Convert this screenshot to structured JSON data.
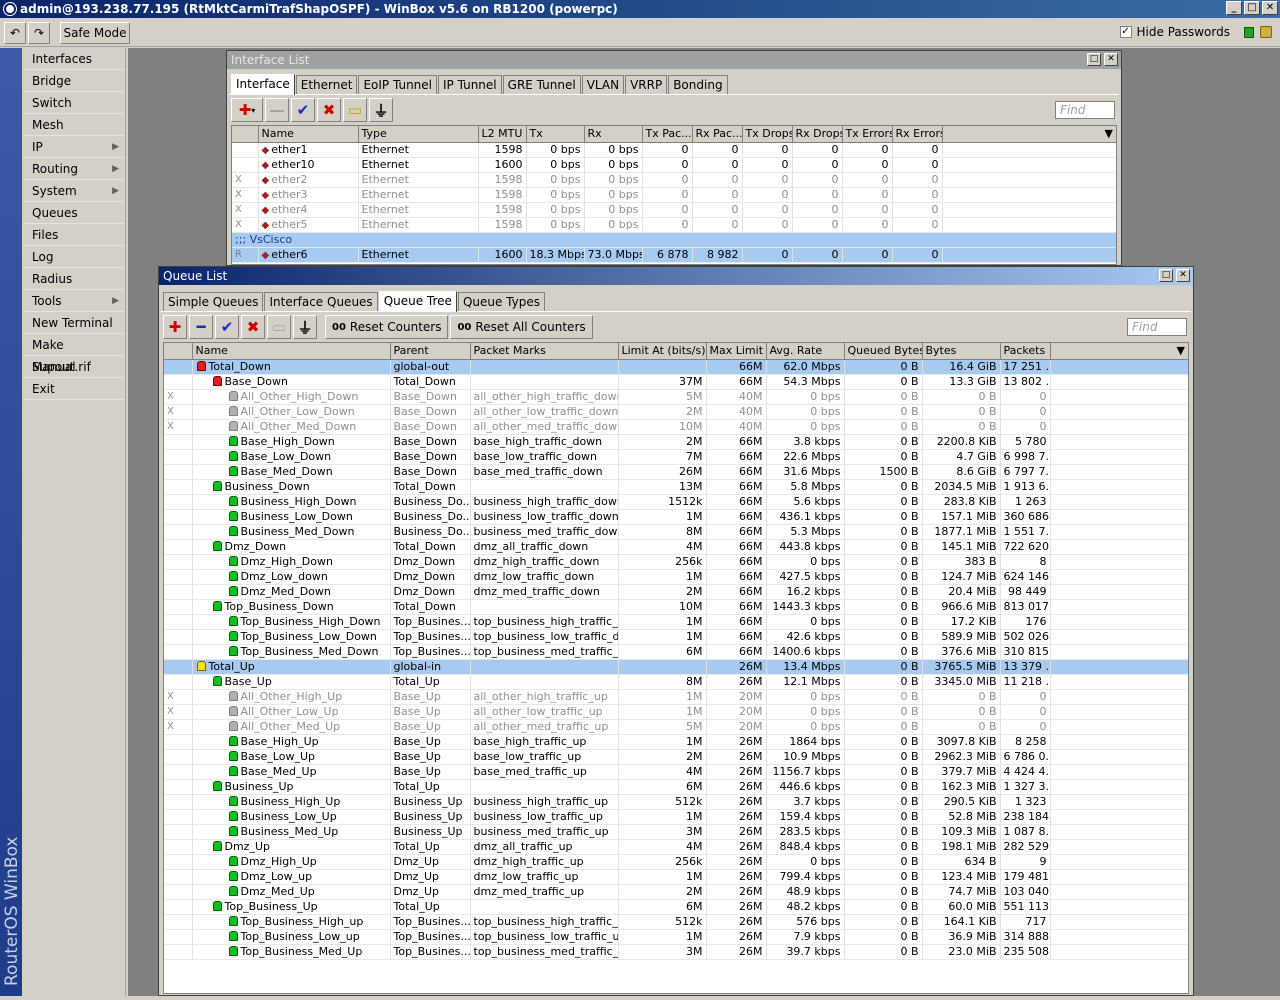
{
  "app": {
    "title": "admin@193.238.77.195 (RtMktCarmiTrafShapOSPF) - WinBox v5.6 on RB1200 (powerpc)",
    "safe_mode": "Safe Mode",
    "hide_passwords": "Hide Passwords",
    "brand": "RouterOS WinBox"
  },
  "sidebar": {
    "items": [
      {
        "label": "Interfaces",
        "sub": false
      },
      {
        "label": "Bridge",
        "sub": false
      },
      {
        "label": "Switch",
        "sub": false
      },
      {
        "label": "Mesh",
        "sub": false
      },
      {
        "label": "IP",
        "sub": true
      },
      {
        "label": "Routing",
        "sub": true
      },
      {
        "label": "System",
        "sub": true
      },
      {
        "label": "Queues",
        "sub": false
      },
      {
        "label": "Files",
        "sub": false
      },
      {
        "label": "Log",
        "sub": false
      },
      {
        "label": "Radius",
        "sub": false
      },
      {
        "label": "Tools",
        "sub": true
      },
      {
        "label": "New Terminal",
        "sub": false
      },
      {
        "label": "Make Supout.rif",
        "sub": false
      },
      {
        "label": "Manual",
        "sub": false
      },
      {
        "label": "Exit",
        "sub": false
      }
    ]
  },
  "iface": {
    "title": "Interface List",
    "tabs": [
      "Interface",
      "Ethernet",
      "EoIP Tunnel",
      "IP Tunnel",
      "GRE Tunnel",
      "VLAN",
      "VRRP",
      "Bonding"
    ],
    "find": "Find",
    "columns": [
      "",
      "Name",
      "Type",
      "L2 MTU",
      "Tx",
      "Rx",
      "Tx Pac...",
      "Rx Pac...",
      "Tx Drops",
      "Rx Drops",
      "Tx Errors",
      "Rx Errors"
    ],
    "rows": [
      {
        "flag": "",
        "name": "ether1",
        "type": "Ethernet",
        "mtu": "1598",
        "tx": "0 bps",
        "rx": "0 bps",
        "txp": "0",
        "rxp": "0",
        "txd": "0",
        "rxd": "0",
        "txe": "0",
        "rxe": "0",
        "state": ""
      },
      {
        "flag": "",
        "name": "ether10",
        "type": "Ethernet",
        "mtu": "1600",
        "tx": "0 bps",
        "rx": "0 bps",
        "txp": "0",
        "rxp": "0",
        "txd": "0",
        "rxd": "0",
        "txe": "0",
        "rxe": "0",
        "state": ""
      },
      {
        "flag": "X",
        "name": "ether2",
        "type": "Ethernet",
        "mtu": "1598",
        "tx": "0 bps",
        "rx": "0 bps",
        "txp": "0",
        "rxp": "0",
        "txd": "0",
        "rxd": "0",
        "txe": "0",
        "rxe": "0",
        "state": "dis"
      },
      {
        "flag": "X",
        "name": "ether3",
        "type": "Ethernet",
        "mtu": "1598",
        "tx": "0 bps",
        "rx": "0 bps",
        "txp": "0",
        "rxp": "0",
        "txd": "0",
        "rxd": "0",
        "txe": "0",
        "rxe": "0",
        "state": "dis"
      },
      {
        "flag": "X",
        "name": "ether4",
        "type": "Ethernet",
        "mtu": "1598",
        "tx": "0 bps",
        "rx": "0 bps",
        "txp": "0",
        "rxp": "0",
        "txd": "0",
        "rxd": "0",
        "txe": "0",
        "rxe": "0",
        "state": "dis"
      },
      {
        "flag": "X",
        "name": "ether5",
        "type": "Ethernet",
        "mtu": "1598",
        "tx": "0 bps",
        "rx": "0 bps",
        "txp": "0",
        "rxp": "0",
        "txd": "0",
        "rxd": "0",
        "txe": "0",
        "rxe": "0",
        "state": "dis"
      },
      {
        "comment": ";;; VsCisco"
      },
      {
        "flag": "R",
        "name": "ether6",
        "type": "Ethernet",
        "mtu": "1600",
        "tx": "18.3 Mbps",
        "rx": "73.0 Mbps",
        "txp": "6 878",
        "rxp": "8 982",
        "txd": "0",
        "rxd": "0",
        "txe": "0",
        "rxe": "0",
        "state": "hl"
      }
    ]
  },
  "queue": {
    "title": "Queue List",
    "tabs": [
      "Simple Queues",
      "Interface Queues",
      "Queue Tree",
      "Queue Types"
    ],
    "reset_counters": "Reset Counters",
    "reset_all": "Reset All Counters",
    "counter_icon": "00",
    "find": "Find",
    "columns": [
      "",
      "Name",
      "Parent",
      "Packet Marks",
      "Limit At (bits/s)",
      "Max Limit ...",
      "Avg. Rate",
      "Queued Bytes",
      "Bytes",
      "Packets"
    ],
    "rows": [
      {
        "f": "",
        "lvl": 0,
        "ic": "red",
        "name": "Total_Down",
        "parent": "global-out",
        "marks": "",
        "limit": "",
        "max": "66M",
        "rate": "62.0 Mbps",
        "qb": "0 B",
        "bytes": "16.4 GiB",
        "pk": "17 251 ...",
        "hl": true
      },
      {
        "f": "",
        "lvl": 1,
        "ic": "red",
        "name": "Base_Down",
        "parent": "Total_Down",
        "marks": "",
        "limit": "37M",
        "max": "66M",
        "rate": "54.3 Mbps",
        "qb": "0 B",
        "bytes": "13.3 GiB",
        "pk": "13 802 ..."
      },
      {
        "f": "X",
        "lvl": 2,
        "ic": "gray",
        "name": "All_Other_High_Down",
        "parent": "Base_Down",
        "marks": "all_other_high_traffic_down",
        "limit": "5M",
        "max": "40M",
        "rate": "0 bps",
        "qb": "0 B",
        "bytes": "0 B",
        "pk": "0",
        "dis": true
      },
      {
        "f": "X",
        "lvl": 2,
        "ic": "gray",
        "name": "All_Other_Low_Down",
        "parent": "Base_Down",
        "marks": "all_other_low_traffic_down",
        "limit": "2M",
        "max": "40M",
        "rate": "0 bps",
        "qb": "0 B",
        "bytes": "0 B",
        "pk": "0",
        "dis": true
      },
      {
        "f": "X",
        "lvl": 2,
        "ic": "gray",
        "name": "All_Other_Med_Down",
        "parent": "Base_Down",
        "marks": "all_other_med_traffic_down",
        "limit": "10M",
        "max": "40M",
        "rate": "0 bps",
        "qb": "0 B",
        "bytes": "0 B",
        "pk": "0",
        "dis": true
      },
      {
        "f": "",
        "lvl": 2,
        "ic": "green",
        "name": "Base_High_Down",
        "parent": "Base_Down",
        "marks": "base_high_traffic_down",
        "limit": "2M",
        "max": "66M",
        "rate": "3.8 kbps",
        "qb": "0 B",
        "bytes": "2200.8 KiB",
        "pk": "5 780"
      },
      {
        "f": "",
        "lvl": 2,
        "ic": "green",
        "name": "Base_Low_Down",
        "parent": "Base_Down",
        "marks": "base_low_traffic_down",
        "limit": "7M",
        "max": "66M",
        "rate": "22.6 Mbps",
        "qb": "0 B",
        "bytes": "4.7 GiB",
        "pk": "6 998 7..."
      },
      {
        "f": "",
        "lvl": 2,
        "ic": "green",
        "name": "Base_Med_Down",
        "parent": "Base_Down",
        "marks": "base_med_traffic_down",
        "limit": "26M",
        "max": "66M",
        "rate": "31.6 Mbps",
        "qb": "1500 B",
        "bytes": "8.6 GiB",
        "pk": "6 797 7..."
      },
      {
        "f": "",
        "lvl": 1,
        "ic": "green",
        "name": "Business_Down",
        "parent": "Total_Down",
        "marks": "",
        "limit": "13M",
        "max": "66M",
        "rate": "5.8 Mbps",
        "qb": "0 B",
        "bytes": "2034.5 MiB",
        "pk": "1 913 6..."
      },
      {
        "f": "",
        "lvl": 2,
        "ic": "green",
        "name": "Business_High_Down",
        "parent": "Business_Do...",
        "marks": "business_high_traffic_down",
        "limit": "1512k",
        "max": "66M",
        "rate": "5.6 kbps",
        "qb": "0 B",
        "bytes": "283.8 KiB",
        "pk": "1 263"
      },
      {
        "f": "",
        "lvl": 2,
        "ic": "green",
        "name": "Business_Low_Down",
        "parent": "Business_Do...",
        "marks": "business_low_traffic_down",
        "limit": "1M",
        "max": "66M",
        "rate": "436.1 kbps",
        "qb": "0 B",
        "bytes": "157.1 MiB",
        "pk": "360 686"
      },
      {
        "f": "",
        "lvl": 2,
        "ic": "green",
        "name": "Business_Med_Down",
        "parent": "Business_Do...",
        "marks": "business_med_traffic_down",
        "limit": "8M",
        "max": "66M",
        "rate": "5.3 Mbps",
        "qb": "0 B",
        "bytes": "1877.1 MiB",
        "pk": "1 551 7..."
      },
      {
        "f": "",
        "lvl": 1,
        "ic": "green",
        "name": "Dmz_Down",
        "parent": "Total_Down",
        "marks": "dmz_all_traffic_down",
        "limit": "4M",
        "max": "66M",
        "rate": "443.8 kbps",
        "qb": "0 B",
        "bytes": "145.1 MiB",
        "pk": "722 620"
      },
      {
        "f": "",
        "lvl": 2,
        "ic": "green",
        "name": "Dmz_High_Down",
        "parent": "Dmz_Down",
        "marks": "dmz_high_traffic_down",
        "limit": "256k",
        "max": "66M",
        "rate": "0 bps",
        "qb": "0 B",
        "bytes": "383 B",
        "pk": "8"
      },
      {
        "f": "",
        "lvl": 2,
        "ic": "green",
        "name": "Dmz_Low_down",
        "parent": "Dmz_Down",
        "marks": "dmz_low_traffic_down",
        "limit": "1M",
        "max": "66M",
        "rate": "427.5 kbps",
        "qb": "0 B",
        "bytes": "124.7 MiB",
        "pk": "624 146"
      },
      {
        "f": "",
        "lvl": 2,
        "ic": "green",
        "name": "Dmz_Med_Down",
        "parent": "Dmz_Down",
        "marks": "dmz_med_traffic_down",
        "limit": "2M",
        "max": "66M",
        "rate": "16.2 kbps",
        "qb": "0 B",
        "bytes": "20.4 MiB",
        "pk": "98 449"
      },
      {
        "f": "",
        "lvl": 1,
        "ic": "green",
        "name": "Top_Business_Down",
        "parent": "Total_Down",
        "marks": "",
        "limit": "10M",
        "max": "66M",
        "rate": "1443.3 kbps",
        "qb": "0 B",
        "bytes": "966.6 MiB",
        "pk": "813 017"
      },
      {
        "f": "",
        "lvl": 2,
        "ic": "green",
        "name": "Top_Business_High_Down",
        "parent": "Top_Busines...",
        "marks": "top_business_high_traffic_d...",
        "limit": "1M",
        "max": "66M",
        "rate": "0 bps",
        "qb": "0 B",
        "bytes": "17.2 KiB",
        "pk": "176"
      },
      {
        "f": "",
        "lvl": 2,
        "ic": "green",
        "name": "Top_Business_Low_Down",
        "parent": "Top_Busines...",
        "marks": "top_business_low_traffic_do...",
        "limit": "1M",
        "max": "66M",
        "rate": "42.6 kbps",
        "qb": "0 B",
        "bytes": "589.9 MiB",
        "pk": "502 026"
      },
      {
        "f": "",
        "lvl": 2,
        "ic": "green",
        "name": "Top_Business_Med_Down",
        "parent": "Top_Busines...",
        "marks": "top_business_med_traffic_d...",
        "limit": "6M",
        "max": "66M",
        "rate": "1400.6 kbps",
        "qb": "0 B",
        "bytes": "376.6 MiB",
        "pk": "310 815"
      },
      {
        "f": "",
        "lvl": 0,
        "ic": "yellow",
        "name": "Total_Up",
        "parent": "global-in",
        "marks": "",
        "limit": "",
        "max": "26M",
        "rate": "13.4 Mbps",
        "qb": "0 B",
        "bytes": "3765.5 MiB",
        "pk": "13 379 ...",
        "hl": true
      },
      {
        "f": "",
        "lvl": 1,
        "ic": "green",
        "name": "Base_Up",
        "parent": "Total_Up",
        "marks": "",
        "limit": "8M",
        "max": "26M",
        "rate": "12.1 Mbps",
        "qb": "0 B",
        "bytes": "3345.0 MiB",
        "pk": "11 218 ..."
      },
      {
        "f": "X",
        "lvl": 2,
        "ic": "gray",
        "name": "All_Other_High_Up",
        "parent": "Base_Up",
        "marks": "all_other_high_traffic_up",
        "limit": "1M",
        "max": "20M",
        "rate": "0 bps",
        "qb": "0 B",
        "bytes": "0 B",
        "pk": "0",
        "dis": true
      },
      {
        "f": "X",
        "lvl": 2,
        "ic": "gray",
        "name": "All_Other_Low_Up",
        "parent": "Base_Up",
        "marks": "all_other_low_traffic_up",
        "limit": "1M",
        "max": "20M",
        "rate": "0 bps",
        "qb": "0 B",
        "bytes": "0 B",
        "pk": "0",
        "dis": true
      },
      {
        "f": "X",
        "lvl": 2,
        "ic": "gray",
        "name": "All_Other_Med_Up",
        "parent": "Base_Up",
        "marks": "all_other_med_traffic_up",
        "limit": "5M",
        "max": "20M",
        "rate": "0 bps",
        "qb": "0 B",
        "bytes": "0 B",
        "pk": "0",
        "dis": true
      },
      {
        "f": "",
        "lvl": 2,
        "ic": "green",
        "name": "Base_High_Up",
        "parent": "Base_Up",
        "marks": "base_high_traffic_up",
        "limit": "1M",
        "max": "26M",
        "rate": "1864 bps",
        "qb": "0 B",
        "bytes": "3097.8 KiB",
        "pk": "8 258"
      },
      {
        "f": "",
        "lvl": 2,
        "ic": "green",
        "name": "Base_Low_Up",
        "parent": "Base_Up",
        "marks": "base_low_traffic_up",
        "limit": "2M",
        "max": "26M",
        "rate": "10.9 Mbps",
        "qb": "0 B",
        "bytes": "2962.3 MiB",
        "pk": "6 786 0..."
      },
      {
        "f": "",
        "lvl": 2,
        "ic": "green",
        "name": "Base_Med_Up",
        "parent": "Base_Up",
        "marks": "base_med_traffic_up",
        "limit": "4M",
        "max": "26M",
        "rate": "1156.7 kbps",
        "qb": "0 B",
        "bytes": "379.7 MiB",
        "pk": "4 424 4..."
      },
      {
        "f": "",
        "lvl": 1,
        "ic": "green",
        "name": "Business_Up",
        "parent": "Total_Up",
        "marks": "",
        "limit": "6M",
        "max": "26M",
        "rate": "446.6 kbps",
        "qb": "0 B",
        "bytes": "162.3 MiB",
        "pk": "1 327 3..."
      },
      {
        "f": "",
        "lvl": 2,
        "ic": "green",
        "name": "Business_High_Up",
        "parent": "Business_Up",
        "marks": "business_high_traffic_up",
        "limit": "512k",
        "max": "26M",
        "rate": "3.7 kbps",
        "qb": "0 B",
        "bytes": "290.5 KiB",
        "pk": "1 323"
      },
      {
        "f": "",
        "lvl": 2,
        "ic": "green",
        "name": "Business_Low_Up",
        "parent": "Business_Up",
        "marks": "business_low_traffic_up",
        "limit": "1M",
        "max": "26M",
        "rate": "159.4 kbps",
        "qb": "0 B",
        "bytes": "52.8 MiB",
        "pk": "238 184"
      },
      {
        "f": "",
        "lvl": 2,
        "ic": "green",
        "name": "Business_Med_Up",
        "parent": "Business_Up",
        "marks": "business_med_traffic_up",
        "limit": "3M",
        "max": "26M",
        "rate": "283.5 kbps",
        "qb": "0 B",
        "bytes": "109.3 MiB",
        "pk": "1 087 8..."
      },
      {
        "f": "",
        "lvl": 1,
        "ic": "green",
        "name": "Dmz_Up",
        "parent": "Total_Up",
        "marks": "dmz_all_traffic_up",
        "limit": "4M",
        "max": "26M",
        "rate": "848.4 kbps",
        "qb": "0 B",
        "bytes": "198.1 MiB",
        "pk": "282 529"
      },
      {
        "f": "",
        "lvl": 2,
        "ic": "green",
        "name": "Dmz_High_Up",
        "parent": "Dmz_Up",
        "marks": "dmz_high_traffic_up",
        "limit": "256k",
        "max": "26M",
        "rate": "0 bps",
        "qb": "0 B",
        "bytes": "634 B",
        "pk": "9"
      },
      {
        "f": "",
        "lvl": 2,
        "ic": "green",
        "name": "Dmz_Low_up",
        "parent": "Dmz_Up",
        "marks": "dmz_low_traffic_up",
        "limit": "1M",
        "max": "26M",
        "rate": "799.4 kbps",
        "qb": "0 B",
        "bytes": "123.4 MiB",
        "pk": "179 481"
      },
      {
        "f": "",
        "lvl": 2,
        "ic": "green",
        "name": "Dmz_Med_Up",
        "parent": "Dmz_Up",
        "marks": "dmz_med_traffic_up",
        "limit": "2M",
        "max": "26M",
        "rate": "48.9 kbps",
        "qb": "0 B",
        "bytes": "74.7 MiB",
        "pk": "103 040"
      },
      {
        "f": "",
        "lvl": 1,
        "ic": "green",
        "name": "Top_Business_Up",
        "parent": "Total_Up",
        "marks": "",
        "limit": "6M",
        "max": "26M",
        "rate": "48.2 kbps",
        "qb": "0 B",
        "bytes": "60.0 MiB",
        "pk": "551 113"
      },
      {
        "f": "",
        "lvl": 2,
        "ic": "green",
        "name": "Top_Business_High_up",
        "parent": "Top_Busines...",
        "marks": "top_business_high_traffic_up",
        "limit": "512k",
        "max": "26M",
        "rate": "576 bps",
        "qb": "0 B",
        "bytes": "164.1 KiB",
        "pk": "717"
      },
      {
        "f": "",
        "lvl": 2,
        "ic": "green",
        "name": "Top_Business_Low_up",
        "parent": "Top_Busines...",
        "marks": "top_business_low_traffic_up",
        "limit": "1M",
        "max": "26M",
        "rate": "7.9 kbps",
        "qb": "0 B",
        "bytes": "36.9 MiB",
        "pk": "314 888"
      },
      {
        "f": "",
        "lvl": 2,
        "ic": "green",
        "name": "Top_Business_Med_Up",
        "parent": "Top_Busines...",
        "marks": "top_business_med_traffic_up",
        "limit": "3M",
        "max": "26M",
        "rate": "39.7 kbps",
        "qb": "0 B",
        "bytes": "23.0 MiB",
        "pk": "235 508"
      }
    ]
  }
}
